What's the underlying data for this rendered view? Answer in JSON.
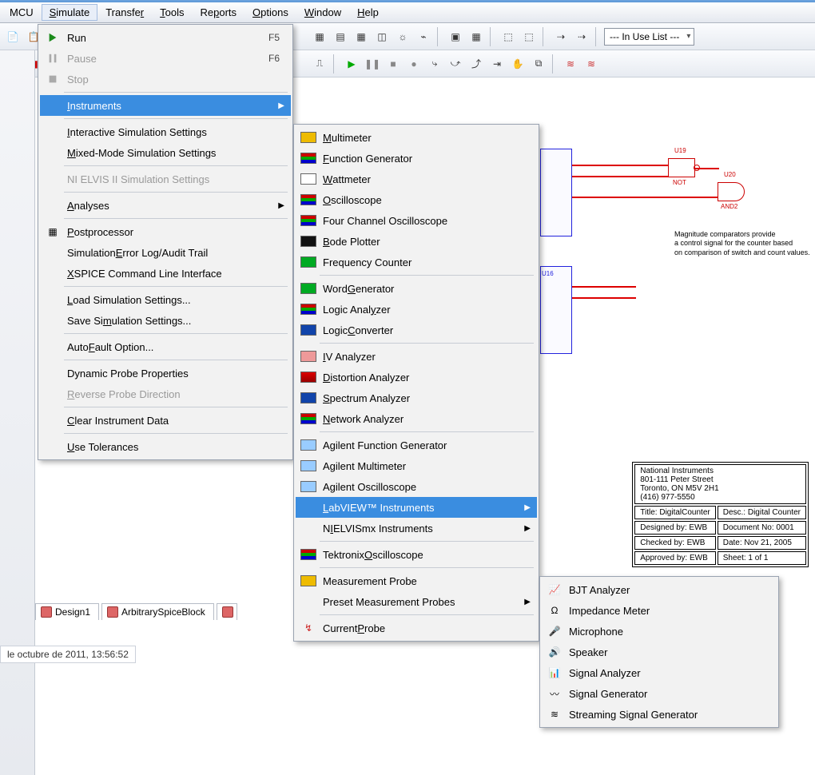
{
  "menubar": {
    "mcu": "MCU",
    "simulate": "Simulate",
    "transfer": "Transfer",
    "tools": "Tools",
    "reports": "Reports",
    "options": "Options",
    "window": "Window",
    "help": "Help"
  },
  "toolbar": {
    "in_use_list": "--- In Use List ---"
  },
  "simulate_menu": {
    "run": "Run",
    "run_sc": "F5",
    "pause": "Pause",
    "pause_sc": "F6",
    "stop": "Stop",
    "instruments": "Instruments",
    "interactive": "Interactive Simulation Settings",
    "mixed": "Mixed-Mode Simulation Settings",
    "nielvis": "NI ELVIS II Simulation Settings",
    "analyses": "Analyses",
    "postprocessor": "Postprocessor",
    "errorlog": "Simulation Error Log/Audit Trail",
    "xspice": "XSPICE Command Line Interface",
    "load": "Load Simulation Settings...",
    "save": "Save Simulation Settings...",
    "autofault": "Auto Fault Option...",
    "dynprobe": "Dynamic Probe Properties",
    "revprobe": "Reverse Probe Direction",
    "cleardata": "Clear Instrument Data",
    "usetol": "Use Tolerances"
  },
  "instruments_menu": {
    "multimeter": "Multimeter",
    "funcgen": "Function Generator",
    "wattmeter": "Wattmeter",
    "oscope": "Oscilloscope",
    "fourch": "Four Channel Oscilloscope",
    "bode": "Bode Plotter",
    "freqcount": "Frequency Counter",
    "wordgen": "Word Generator",
    "loganalyzer": "Logic Analyzer",
    "logconv": "Logic Converter",
    "iv": "IV Analyzer",
    "dist": "Distortion Analyzer",
    "spectrum": "Spectrum Analyzer",
    "network": "Network Analyzer",
    "agfuncgen": "Agilent Function Generator",
    "agmulti": "Agilent Multimeter",
    "agscope": "Agilent Oscilloscope",
    "labview": "LabVIEW™ Instruments",
    "nielvismx": "NI ELVISmx Instruments",
    "tekscope": "Tektronix Oscilloscope",
    "measprobe": "Measurement Probe",
    "presetprobes": "Preset Measurement Probes",
    "currentprobe": "Current Probe"
  },
  "labview_menu": {
    "bjt": "BJT Analyzer",
    "imp": "Impedance Meter",
    "mic": "Microphone",
    "spk": "Speaker",
    "sigan": "Signal Analyzer",
    "siggen": "Signal Generator",
    "streamgen": "Streaming Signal Generator"
  },
  "tabs": {
    "design1": "Design1",
    "arb": "ArbitrarySpiceBlock"
  },
  "status": {
    "text": "le octubre de 2011, 13:56:52"
  },
  "schem": {
    "note_l1": "Magnitude comparators provide",
    "note_l2": "a control signal for the counter based",
    "note_l3": "on comparison of switch and count values.",
    "u19": "U19",
    "not": "NOT",
    "u20": "U20",
    "and2": "AND2",
    "u16": "U16"
  },
  "titleblock": {
    "company": "National Instruments",
    "addr1": "801-111 Peter Street",
    "addr2": "Toronto, ON M5V 2H1",
    "phone": "(416) 977-5550",
    "title_k": "Title:",
    "title_v": "DigitalCounter",
    "desc_k": "Desc.:",
    "desc_v": "Digital Counter",
    "designed_k": "Designed by:",
    "designed_v": "EWB",
    "doc_k": "Document No:",
    "doc_v": "0001",
    "checked_k": "Checked by:",
    "checked_v": "EWB",
    "date_k": "Date:",
    "date_v": "Nov 21, 2005",
    "approved_k": "Approved by:",
    "approved_v": "EWB",
    "sheet_k": "Sheet:",
    "sheet_v": "1  of  1"
  }
}
